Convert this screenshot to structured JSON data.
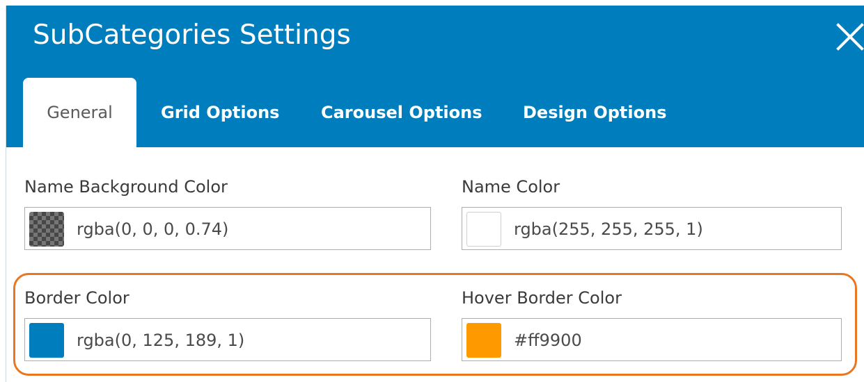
{
  "dialog": {
    "title": "SubCategories Settings",
    "close_icon": "close-icon"
  },
  "tabs": [
    {
      "label": "General",
      "active": true
    },
    {
      "label": "Grid Options",
      "active": false
    },
    {
      "label": "Carousel Options",
      "active": false
    },
    {
      "label": "Design Options",
      "active": false
    }
  ],
  "fields": {
    "name_background_color": {
      "label": "Name Background Color",
      "value": "rgba(0, 0, 0, 0.74)",
      "swatch": "rgba(0, 0, 0, 0.74)"
    },
    "name_color": {
      "label": "Name Color",
      "value": "rgba(255, 255, 255, 1)",
      "swatch": "#ffffff"
    },
    "border_color": {
      "label": "Border Color",
      "value": "rgba(0, 125, 189, 1)",
      "swatch": "#007dbd"
    },
    "hover_border_color": {
      "label": "Hover Border Color",
      "value": "#ff9900",
      "swatch": "#ff9900"
    }
  },
  "colors": {
    "header_blue": "#007dbd",
    "highlight_orange": "#e87722"
  }
}
